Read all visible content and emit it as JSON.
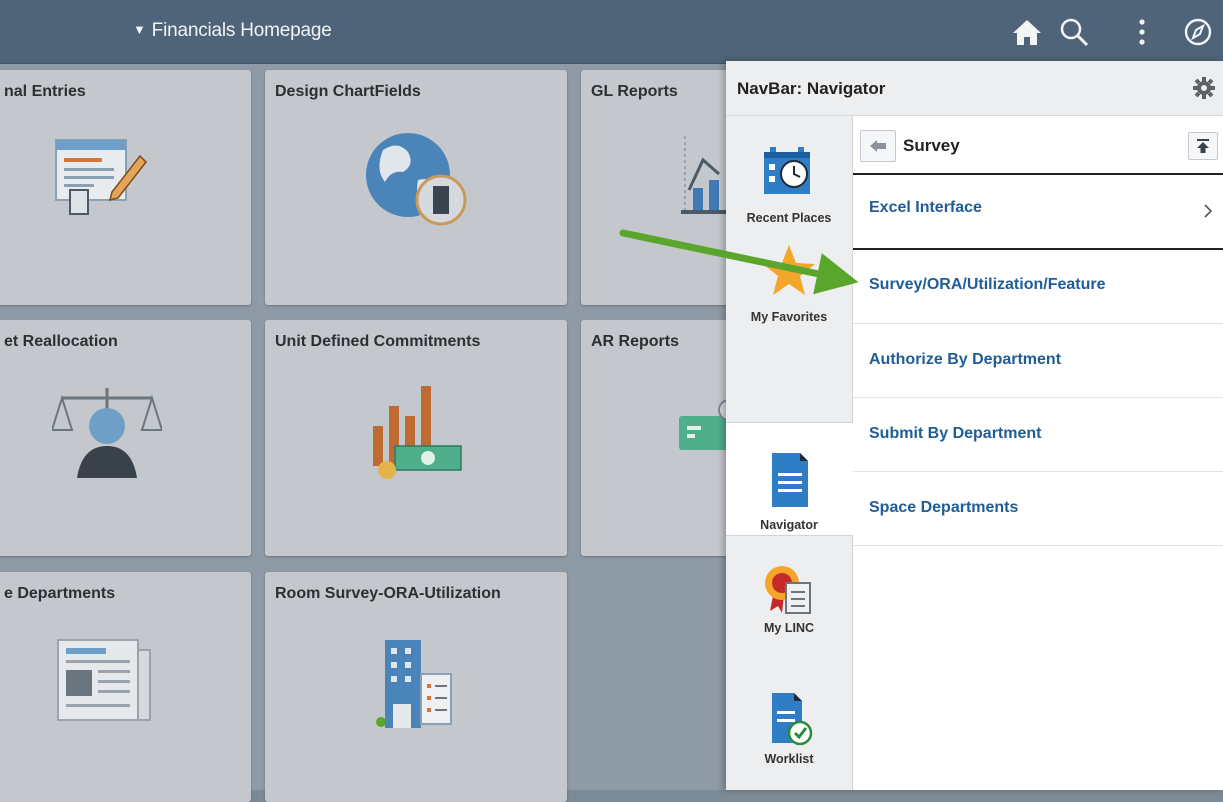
{
  "header": {
    "title": "Financials Homepage",
    "icons": [
      "home-icon",
      "search-icon",
      "actions-menu-icon",
      "navbar-compass-icon"
    ]
  },
  "tiles": [
    {
      "title": "nal Entries",
      "icon": "journal-entry-icon"
    },
    {
      "title": "Design ChartFields",
      "icon": "globe-building-icon"
    },
    {
      "title": "GL Reports",
      "icon": "report-chart-icon"
    },
    {
      "title": "et Reallocation",
      "icon": "scales-person-icon"
    },
    {
      "title": "Unit Defined Commitments",
      "icon": "bar-chart-money-icon"
    },
    {
      "title": "AR Reports",
      "icon": "money-report-icon"
    },
    {
      "title": "e Departments",
      "icon": "newspaper-icon"
    },
    {
      "title": "Room Survey-ORA-Utilization",
      "icon": "building-list-icon"
    }
  ],
  "navbar": {
    "title": "NavBar: Navigator",
    "rail": [
      {
        "label": "Recent Places",
        "icon": "calendar-clock-icon"
      },
      {
        "label": "My Favorites",
        "icon": "star-icon"
      },
      {
        "label": "Navigator",
        "icon": "document-icon"
      },
      {
        "label": "My LINC",
        "icon": "ribbon-document-icon"
      },
      {
        "label": "Worklist",
        "icon": "worklist-check-icon"
      }
    ],
    "breadcrumb": "Survey",
    "menu": [
      {
        "label": "Excel Interface",
        "type": "folder"
      },
      {
        "label": "Survey/ORA/Utilization/Feature",
        "type": "link"
      },
      {
        "label": "Authorize By Department",
        "type": "link"
      },
      {
        "label": "Submit By Department",
        "type": "link"
      },
      {
        "label": "Space Departments",
        "type": "link"
      }
    ]
  },
  "colors": {
    "header_bg": "#4f6479",
    "link_text": "#1f5d96",
    "annotation_arrow": "#5aa52c"
  }
}
